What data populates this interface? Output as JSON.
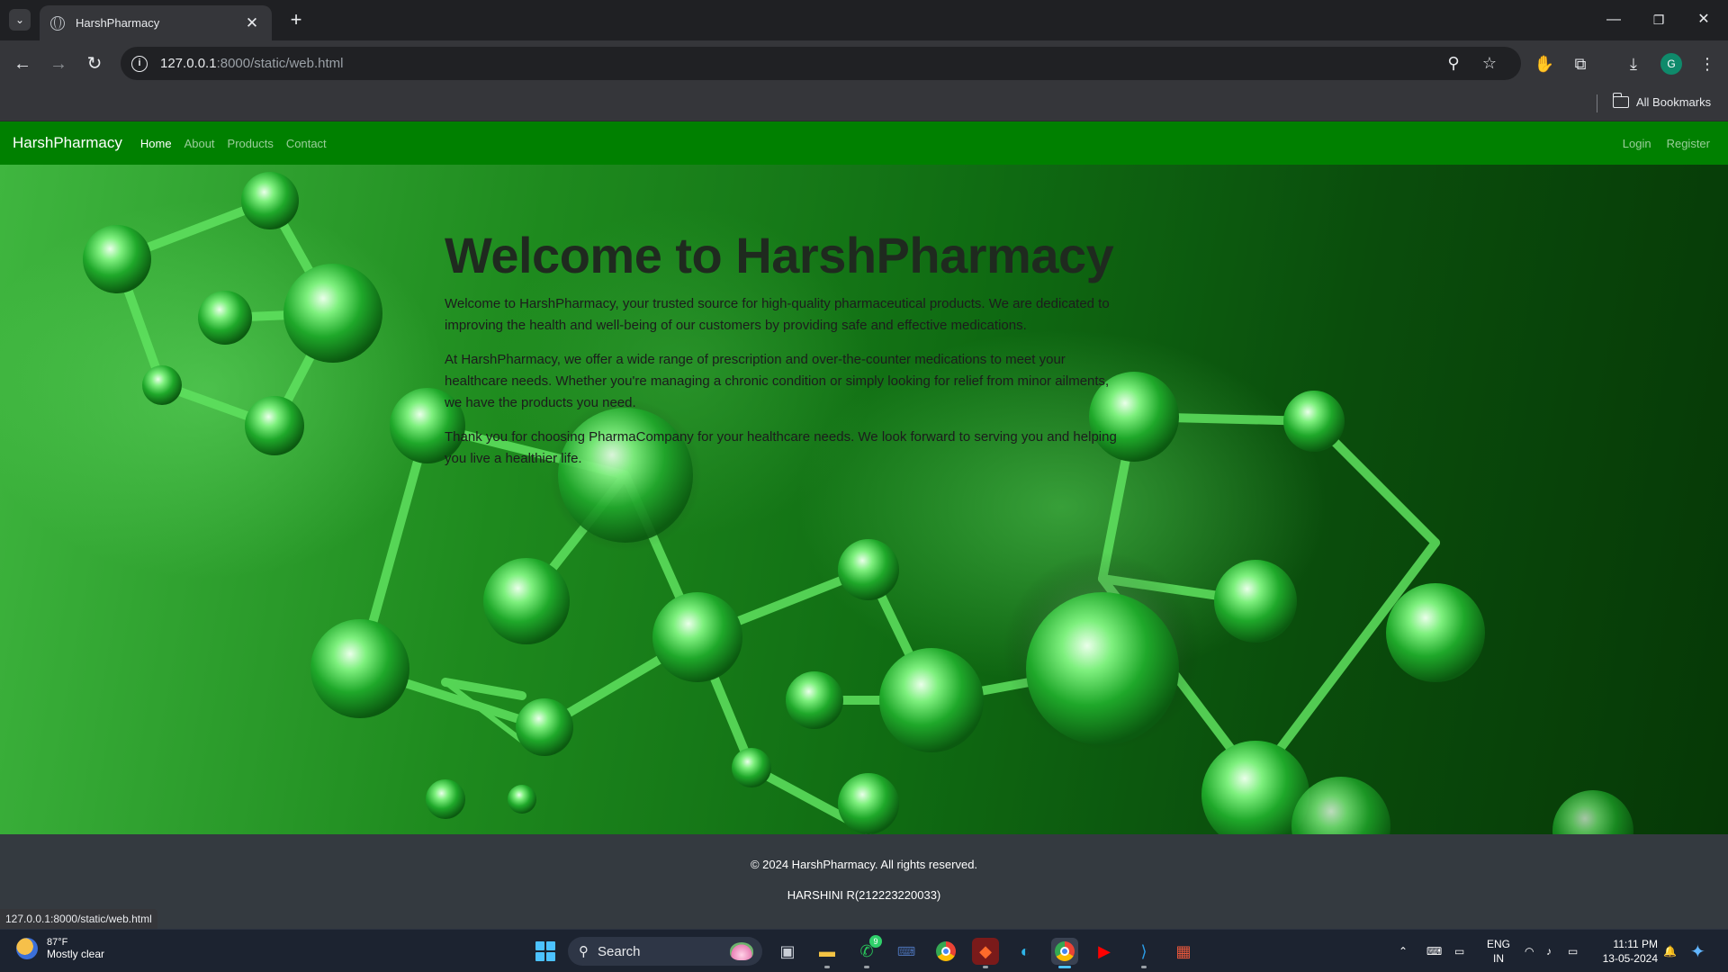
{
  "browser": {
    "tab_title": "HarshPharmacy",
    "url_host": "127.0.0.1",
    "url_path": ":8000/static/web.html",
    "bookmarks_label": "All Bookmarks",
    "profile_initial": "G",
    "status_url": "127.0.0.1:8000/static/web.html"
  },
  "navbar": {
    "brand": "HarshPharmacy",
    "links": [
      "Home",
      "About",
      "Products",
      "Contact"
    ],
    "active": "Home",
    "right_links": [
      "Login",
      "Register"
    ],
    "color": "#008000"
  },
  "hero": {
    "title": "Welcome to HarshPharmacy",
    "paragraphs": [
      "Welcome to HarshPharmacy, your trusted source for high-quality pharmaceutical products. We are dedicated to improving the health and well-being of our customers by providing safe and effective medications.",
      "At HarshPharmacy, we offer a wide range of prescription and over-the-counter medications to meet your healthcare needs. Whether you're managing a chronic condition or simply looking for relief from minor ailments, we have the products you need.",
      "Thank you for choosing PharmaCompany for your healthcare needs. We look forward to serving you and helping you live a healthier life."
    ]
  },
  "footer": {
    "copyright": "© 2024 HarshPharmacy. All rights reserved.",
    "author": "HARSHINI R(212223220033)"
  },
  "taskbar": {
    "weather_temp": "87°F",
    "weather_desc": "Mostly clear",
    "search_label": "Search",
    "whatsapp_badge": "9",
    "lang_line1": "ENG",
    "lang_line2": "IN",
    "time": "11:11 PM",
    "date": "13-05-2024"
  }
}
